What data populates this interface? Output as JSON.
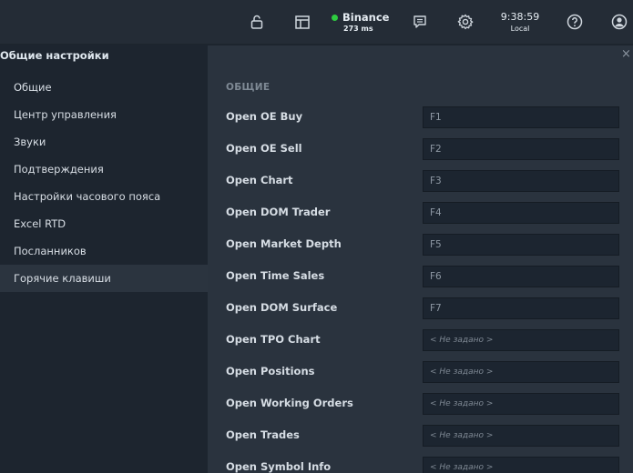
{
  "topbar": {
    "icons": [
      "lock-icon",
      "layout-icon",
      "chat-icon",
      "gear-icon",
      "help-icon",
      "user-icon"
    ],
    "connection": {
      "name": "Binance",
      "ping": "273 ms",
      "status_color": "#2ecc40"
    },
    "clock": {
      "time": "9:38:59",
      "zone": "Local"
    }
  },
  "sidebar": {
    "title": "Общие настройки",
    "items": [
      {
        "label": "Общие"
      },
      {
        "label": "Центр управления"
      },
      {
        "label": "Звуки"
      },
      {
        "label": "Подтверждения"
      },
      {
        "label": "Настройки часового пояса"
      },
      {
        "label": "Excel RTD"
      },
      {
        "label": "Посланников"
      },
      {
        "label": "Горячие клавиши"
      }
    ],
    "active_index": 7
  },
  "main": {
    "close": "×",
    "section": "ОБЩИЕ",
    "rows": [
      {
        "label": "Open OE Buy",
        "value": "F1"
      },
      {
        "label": "Open OE Sell",
        "value": "F2"
      },
      {
        "label": "Open Chart",
        "value": "F3"
      },
      {
        "label": "Open DOM Trader",
        "value": "F4"
      },
      {
        "label": "Open Market Depth",
        "value": "F5"
      },
      {
        "label": "Open Time Sales",
        "value": "F6"
      },
      {
        "label": "Open DOM Surface",
        "value": "F7"
      },
      {
        "label": "Open TPO Chart",
        "value": "< Не задано >"
      },
      {
        "label": "Open Positions",
        "value": "< Не задано >"
      },
      {
        "label": "Open Working Orders",
        "value": "< Не задано >"
      },
      {
        "label": "Open Trades",
        "value": "< Не задано >"
      },
      {
        "label": "Open Symbol Info",
        "value": "< Не задано >"
      }
    ]
  }
}
